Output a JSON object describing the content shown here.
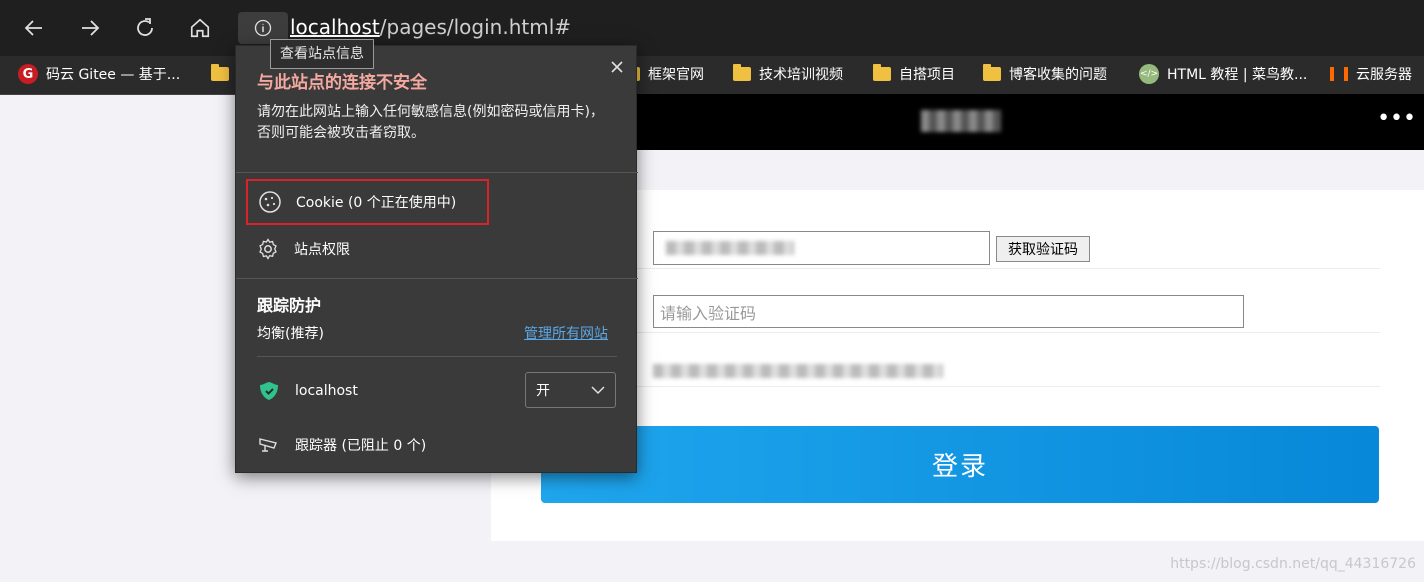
{
  "browser": {
    "url_host": "localhost",
    "url_path": "/pages/login.html#",
    "tooltip": "查看站点信息"
  },
  "bookmarks": [
    {
      "label": "码云 Gitee — 基于...",
      "icon": "gitee-icon"
    },
    {
      "label": "",
      "icon": "folder-icon"
    },
    {
      "label": "框架官网",
      "icon": "folder-icon"
    },
    {
      "label": "技术培训视频",
      "icon": "folder-icon"
    },
    {
      "label": "自搭项目",
      "icon": "folder-icon"
    },
    {
      "label": "博客收集的问题",
      "icon": "folder-icon"
    },
    {
      "label": "HTML 教程 | 菜鸟教...",
      "icon": "runoob-icon"
    },
    {
      "label": "云服务器",
      "icon": "aliyun-icon"
    }
  ],
  "popup": {
    "title": "与此站点的连接不安全",
    "description": "请勿在此网站上输入任何敏感信息(例如密码或信用卡)，否则可能会被攻击者窃取。",
    "cookie_label": "Cookie (0 个正在使用中)",
    "permissions_label": "站点权限",
    "tracking_title": "跟踪防护",
    "tracking_level": "均衡(推荐)",
    "manage_link": "管理所有网站",
    "site_name": "localhost",
    "toggle_value": "开",
    "trackers_label": "跟踪器 (已阻止 0 个)"
  },
  "page": {
    "sms_button": "获取验证码",
    "code_placeholder": "请输入验证码",
    "login_button": "登录",
    "watermark": "https://blog.csdn.net/qq_44316726"
  },
  "colors": {
    "popup_title": "#f4a9a0",
    "highlight_border": "#d9232a",
    "link": "#5aa7e6",
    "login_button": "#1fa6ee"
  }
}
